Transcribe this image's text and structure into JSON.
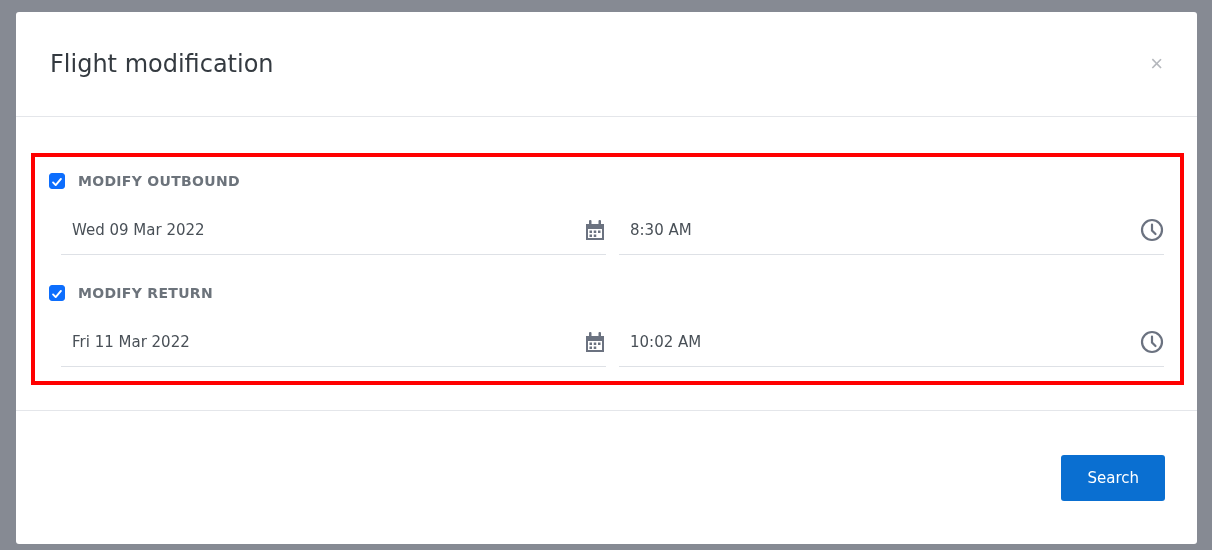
{
  "dialog": {
    "title": "Flight modification",
    "close": "×"
  },
  "sections": [
    {
      "label": "MODIFY OUTBOUND",
      "checked": true,
      "date": "Wed 09 Mar 2022",
      "time": "8:30 AM"
    },
    {
      "label": "MODIFY RETURN",
      "checked": true,
      "date": "Fri 11 Mar 2022",
      "time": "10:02 AM"
    }
  ],
  "buttons": [
    {
      "label": "Search",
      "kind": "primary"
    }
  ]
}
